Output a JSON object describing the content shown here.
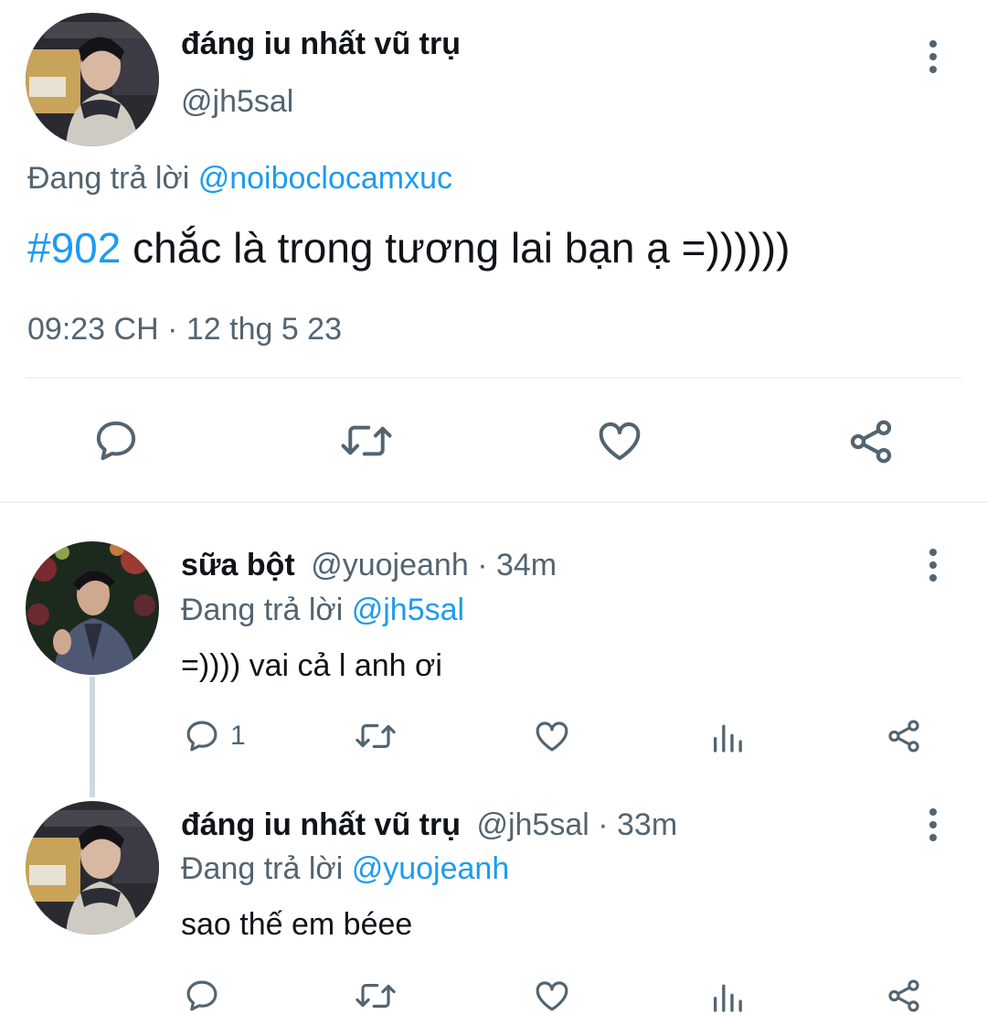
{
  "main_tweet": {
    "display_name": "đáng iu nhất vũ trụ",
    "handle": "@jh5sal",
    "replying_prefix": "Đang trả lời",
    "replying_to": "@noiboclocamxuc",
    "hashtag": "#902",
    "text": " chắc là trong tương lai bạn ạ =))))))",
    "timestamp": "09:23 CH · 12 thg 5 23",
    "actions": [
      "reply-icon",
      "retweet-icon",
      "like-icon",
      "share-icon"
    ]
  },
  "replies": [
    {
      "display_name": "sữa bột",
      "handle": "@yuojeanh",
      "time": "· 34m",
      "replying_prefix": "Đang trả lời",
      "replying_to": "@jh5sal",
      "text": "=)))) vai cả l anh ơi",
      "reply_count": "1"
    },
    {
      "display_name": "đáng iu nhất vũ trụ",
      "handle": "@jh5sal",
      "time": "· 33m",
      "replying_prefix": "Đang trả lời",
      "replying_to": "@yuojeanh",
      "text": "sao thế em béee",
      "reply_count": ""
    }
  ],
  "colors": {
    "link": "#1d9bf0",
    "muted": "#536471",
    "text": "#0f1419",
    "divider": "#eff3f4"
  }
}
